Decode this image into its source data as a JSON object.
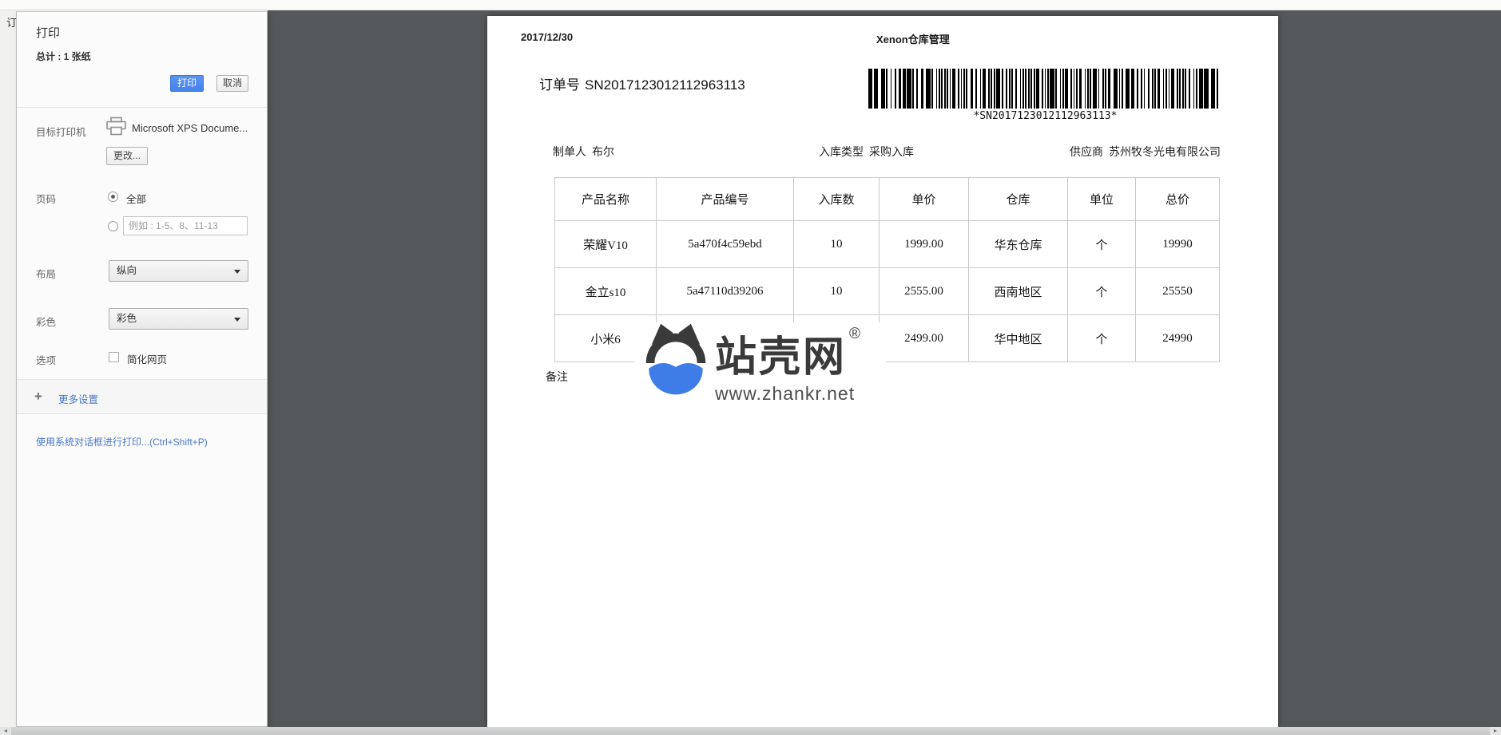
{
  "page": {
    "background_text": "订"
  },
  "print_dialog": {
    "title": "打印",
    "total": "总计 : 1 张纸",
    "print_button": "打印",
    "cancel_button": "取消",
    "destination": {
      "label": "目标打印机",
      "printer_name": "Microsoft XPS Docume...",
      "change_button": "更改..."
    },
    "pages": {
      "label": "页码",
      "all_option": "全部",
      "range_placeholder": "例如 : 1-5、8、11-13"
    },
    "layout": {
      "label": "布局",
      "value": "纵向"
    },
    "color": {
      "label": "彩色",
      "value": "彩色"
    },
    "options": {
      "label": "选项",
      "checkbox_label": "简化网页",
      "checked": false
    },
    "more_settings_label": "更多设置",
    "system_dialog_link": "使用系统对话框进行打印...(Ctrl+Shift+P)"
  },
  "preview": {
    "header_date": "2017/12/30",
    "header_title": "Xenon仓库管理",
    "order_label": "订单号",
    "order_number": "SN2017123012112963113",
    "barcode_text": "*SN2017123012112963113*",
    "meta": {
      "creator_label": "制单人",
      "creator": "布尔",
      "type_label": "入库类型",
      "type": "采购入库",
      "supplier_label": "供应商",
      "supplier": "苏州牧冬光电有限公司"
    },
    "table": {
      "headers": [
        "产品名称",
        "产品编号",
        "入库数",
        "单价",
        "仓库",
        "单位",
        "总价"
      ],
      "rows": [
        [
          "荣耀V10",
          "5a470f4c59ebd",
          "10",
          "1999.00",
          "华东仓库",
          "个",
          "19990"
        ],
        [
          "金立s10",
          "5a47110d39206",
          "10",
          "2555.00",
          "西南地区",
          "个",
          "25550"
        ],
        [
          "小米6",
          "",
          "",
          "2499.00",
          "华中地区",
          "个",
          "24990"
        ]
      ]
    },
    "remarks_label": "备注",
    "watermark": {
      "name": "站壳网",
      "reg": "®",
      "url": "www.zhankr.net"
    }
  },
  "colors": {
    "accent_blue": "#5b93f2",
    "link_blue": "#4977c8",
    "backdrop": "#55585a",
    "watermark_dark": "#3a3a3a",
    "watermark_blue": "#3e7ce8",
    "table_border": "#c9c9c9"
  }
}
